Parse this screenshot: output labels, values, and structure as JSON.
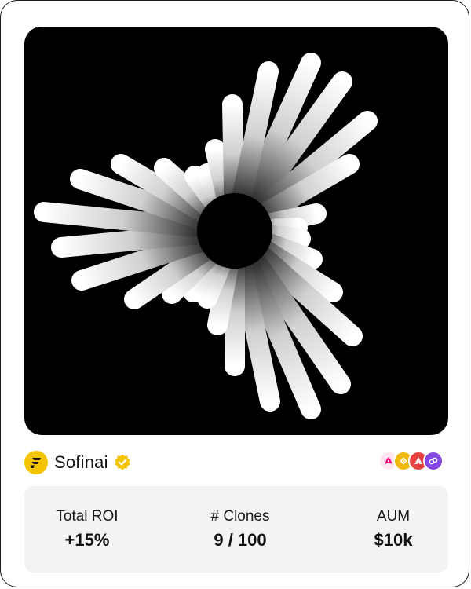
{
  "profile": {
    "name": "Sofinai",
    "logo_icon": "sofinai-logo-icon",
    "verified_icon": "verified-badge-icon",
    "brand_color": "#f5c400"
  },
  "chains": [
    {
      "icon": "uniswap-icon",
      "color": "#fde6f0"
    },
    {
      "icon": "bnb-icon",
      "color": "#f0b90b"
    },
    {
      "icon": "avalanche-icon",
      "color": "#e84142"
    },
    {
      "icon": "polygon-icon",
      "color": "#8247e5"
    }
  ],
  "stats": {
    "roi": {
      "label": "Total ROI",
      "value": "+15%"
    },
    "clones": {
      "label": "# Clones",
      "value": "9 / 100"
    },
    "aum": {
      "label": "AUM",
      "value": "$10k"
    }
  }
}
